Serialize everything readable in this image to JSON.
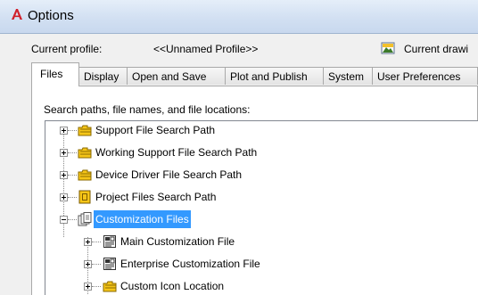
{
  "window": {
    "title": "Options"
  },
  "profile": {
    "label": "Current profile:",
    "value": "<<Unnamed Profile>>",
    "drawing_label": "Current drawi"
  },
  "tabs": [
    {
      "label": "Files",
      "active": true
    },
    {
      "label": "Display",
      "active": false
    },
    {
      "label": "Open and Save",
      "active": false
    },
    {
      "label": "Plot and Publish",
      "active": false
    },
    {
      "label": "System",
      "active": false
    },
    {
      "label": "User Preferences",
      "active": false
    }
  ],
  "files_panel": {
    "caption": "Search paths, file names, and file locations:",
    "tree": [
      {
        "label": "Support File Search Path",
        "icon": "folder-stack-icon",
        "state": "collapsed",
        "selected": false
      },
      {
        "label": "Working Support File Search Path",
        "icon": "folder-stack-icon",
        "state": "collapsed",
        "selected": false
      },
      {
        "label": "Device Driver File Search Path",
        "icon": "folder-stack-icon",
        "state": "collapsed",
        "selected": false
      },
      {
        "label": "Project Files Search Path",
        "icon": "project-file-icon",
        "state": "collapsed",
        "selected": false
      },
      {
        "label": "Customization Files",
        "icon": "document-stack-icon",
        "state": "expanded",
        "selected": true
      },
      {
        "label": "Main Customization File",
        "icon": "cui-file-icon",
        "state": "collapsed",
        "selected": false
      },
      {
        "label": "Enterprise Customization File",
        "icon": "cui-file-icon",
        "state": "collapsed",
        "selected": false
      },
      {
        "label": "Custom Icon Location",
        "icon": "folder-stack-icon",
        "state": "collapsed",
        "selected": false
      }
    ]
  },
  "colors": {
    "selection": "#3399ff",
    "folder": "#f5c518",
    "titlebar": "#d2e0f2"
  }
}
